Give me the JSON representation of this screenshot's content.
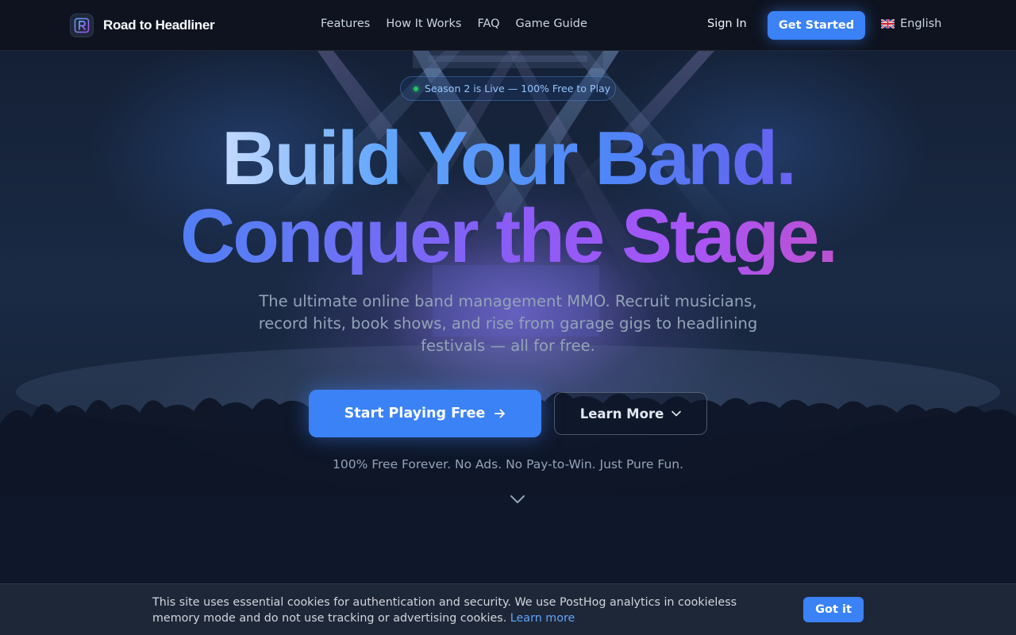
{
  "header": {
    "brand_name": "Road to Headliner",
    "nav": [
      {
        "label": "Features"
      },
      {
        "label": "How It Works"
      },
      {
        "label": "FAQ"
      },
      {
        "label": "Game Guide"
      }
    ],
    "sign_in_label": "Sign In",
    "get_started_label": "Get Started",
    "language_label": "English",
    "language_icon": "uk-flag-icon"
  },
  "hero": {
    "badge_text": "Season 2 is Live — 100% Free to Play",
    "headline_line1": "Build Your Band.",
    "headline_line2": "Conquer the Stage.",
    "subtitle": "The ultimate online band management MMO. Recruit musicians, record hits, book shows, and rise from garage gigs to headlining festivals — all for free.",
    "primary_cta_label": "Start Playing Free",
    "primary_cta_icon": "arrow-right-icon",
    "secondary_cta_label": "Learn More",
    "secondary_cta_icon": "chevron-down-icon",
    "tagline": "100% Free Forever. No Ads. No Pay-to-Win. Just Pure Fun.",
    "scroll_icon": "chevron-down-icon"
  },
  "cookie_banner": {
    "text": "This site uses essential cookies for authentication and security. We use PostHog analytics in cookieless memory mode and do not use tracking or advertising cookies.",
    "link_label": "Learn more",
    "accept_label": "Got it"
  },
  "colors": {
    "accent": "#3b82f6",
    "background": "#0f172a",
    "gradient_start": "#3b82f6",
    "gradient_mid": "#8b5cf6",
    "gradient_end": "#ec4899"
  }
}
